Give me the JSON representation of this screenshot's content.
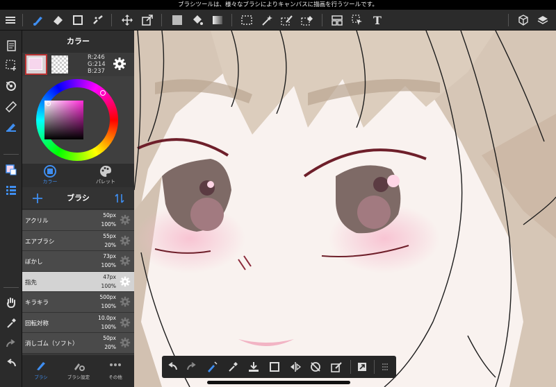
{
  "status_bar": {
    "message": "ブラシツールは、様々なブラシによりキャンバスに描画を行うツールです。"
  },
  "toolbar": {
    "tools": [
      "menu-icon",
      "brush-icon",
      "eraser-icon",
      "rect-select-icon",
      "dot-icon",
      "move-icon",
      "transform-icon",
      "fill-color-icon",
      "bucket-icon",
      "gradient-icon",
      "selection-icon",
      "magic-wand-icon",
      "select-pen-icon",
      "select-eraser-icon",
      "panel-icon",
      "select-arrow-icon",
      "text-icon",
      "3d-icon",
      "layers-icon"
    ],
    "text_tool_glyph": "T"
  },
  "color_panel": {
    "title": "カラー",
    "main_color": "#f6d6ed",
    "rgb": {
      "r": "R:246",
      "g": "G:214",
      "b": "B:237"
    },
    "tabs": [
      {
        "label": "カラー",
        "icon": "color-wheel-icon"
      },
      {
        "label": "パレット",
        "icon": "palette-icon"
      }
    ]
  },
  "brush_panel": {
    "title": "ブラシ",
    "brushes": [
      {
        "name": "アクリル",
        "size": "50px",
        "opacity": "100%"
      },
      {
        "name": "エアブラシ",
        "size": "55px",
        "opacity": "20%"
      },
      {
        "name": "ぼかし",
        "size": "73px",
        "opacity": "100%"
      },
      {
        "name": "指先",
        "size": "47px",
        "opacity": "100%",
        "selected": true
      },
      {
        "name": "キラキラ",
        "size": "500px",
        "opacity": "100%"
      },
      {
        "name": "回転対称",
        "size": "10.0px",
        "opacity": "100%"
      },
      {
        "name": "消しゴム（ソフト）",
        "size": "50px",
        "opacity": "20%"
      }
    ]
  },
  "panel_bottom": {
    "items": [
      {
        "label": "ブラシ"
      },
      {
        "label": "ブラシ設定"
      },
      {
        "label": "その他"
      }
    ]
  },
  "float_bar": {
    "tools": [
      "undo-icon",
      "redo-icon",
      "brush-swap-icon",
      "eyedropper-icon",
      "save-icon",
      "canvas-fit-icon",
      "flip-icon",
      "rotate-reset-icon",
      "edit-icon",
      "fullscreen-icon",
      "grid-handle-icon"
    ]
  },
  "colors": {
    "accent": "#3f8ef0",
    "selection_red": "#b33333"
  }
}
